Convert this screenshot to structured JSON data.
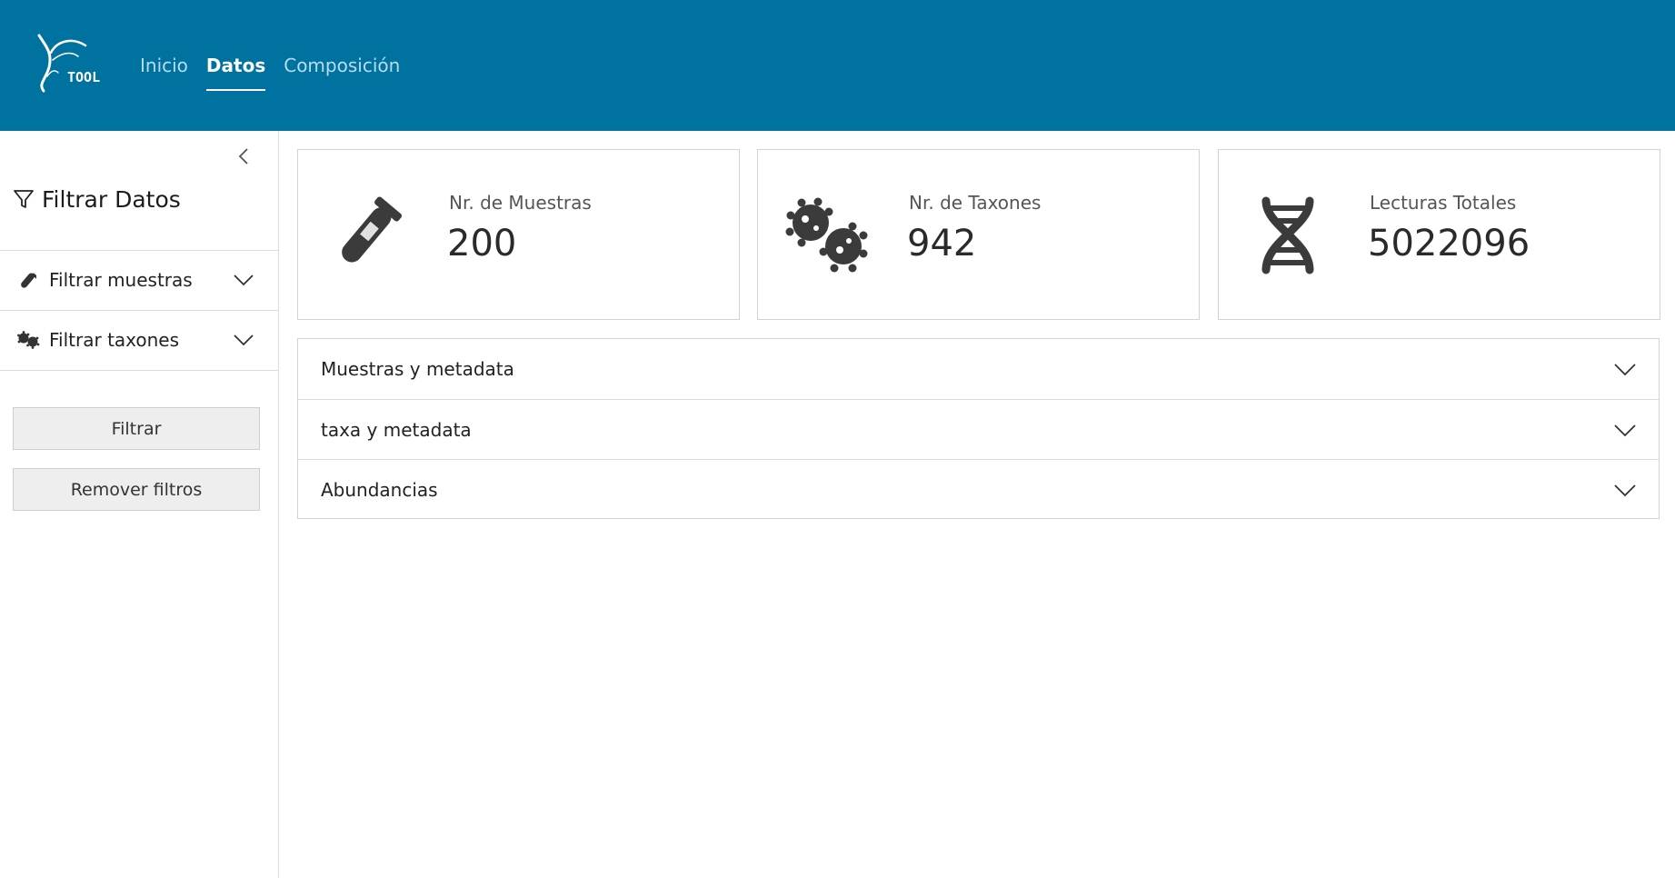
{
  "header": {
    "logo_text": "TOOL",
    "nav": [
      {
        "label": "Inicio",
        "active": false
      },
      {
        "label": "Datos",
        "active": true
      },
      {
        "label": "Composición",
        "active": false
      }
    ],
    "bg_color": "#0072a0"
  },
  "sidebar": {
    "title": "Filtrar Datos",
    "title_icon": "filter-icon",
    "collapse_icon": "chevron-left-icon",
    "filters": [
      {
        "label": "Filtrar muestras",
        "icon": "test-tube-icon"
      },
      {
        "label": "Filtrar taxones",
        "icon": "bacteria-icon"
      }
    ],
    "buttons": {
      "filter_label": "Filtrar",
      "remove_label": "Remover filtros"
    }
  },
  "stats": [
    {
      "label": "Nr. de Muestras",
      "value": "200",
      "icon": "test-tube-icon"
    },
    {
      "label": "Nr. de Taxones",
      "value": "942",
      "icon": "bacteria-icon"
    },
    {
      "label": "Lecturas Totales",
      "value": "5022096",
      "icon": "dna-icon"
    }
  ],
  "accordion": [
    {
      "label": "Muestras y metadata"
    },
    {
      "label": "taxa y metadata"
    },
    {
      "label": "Abundancias"
    }
  ]
}
